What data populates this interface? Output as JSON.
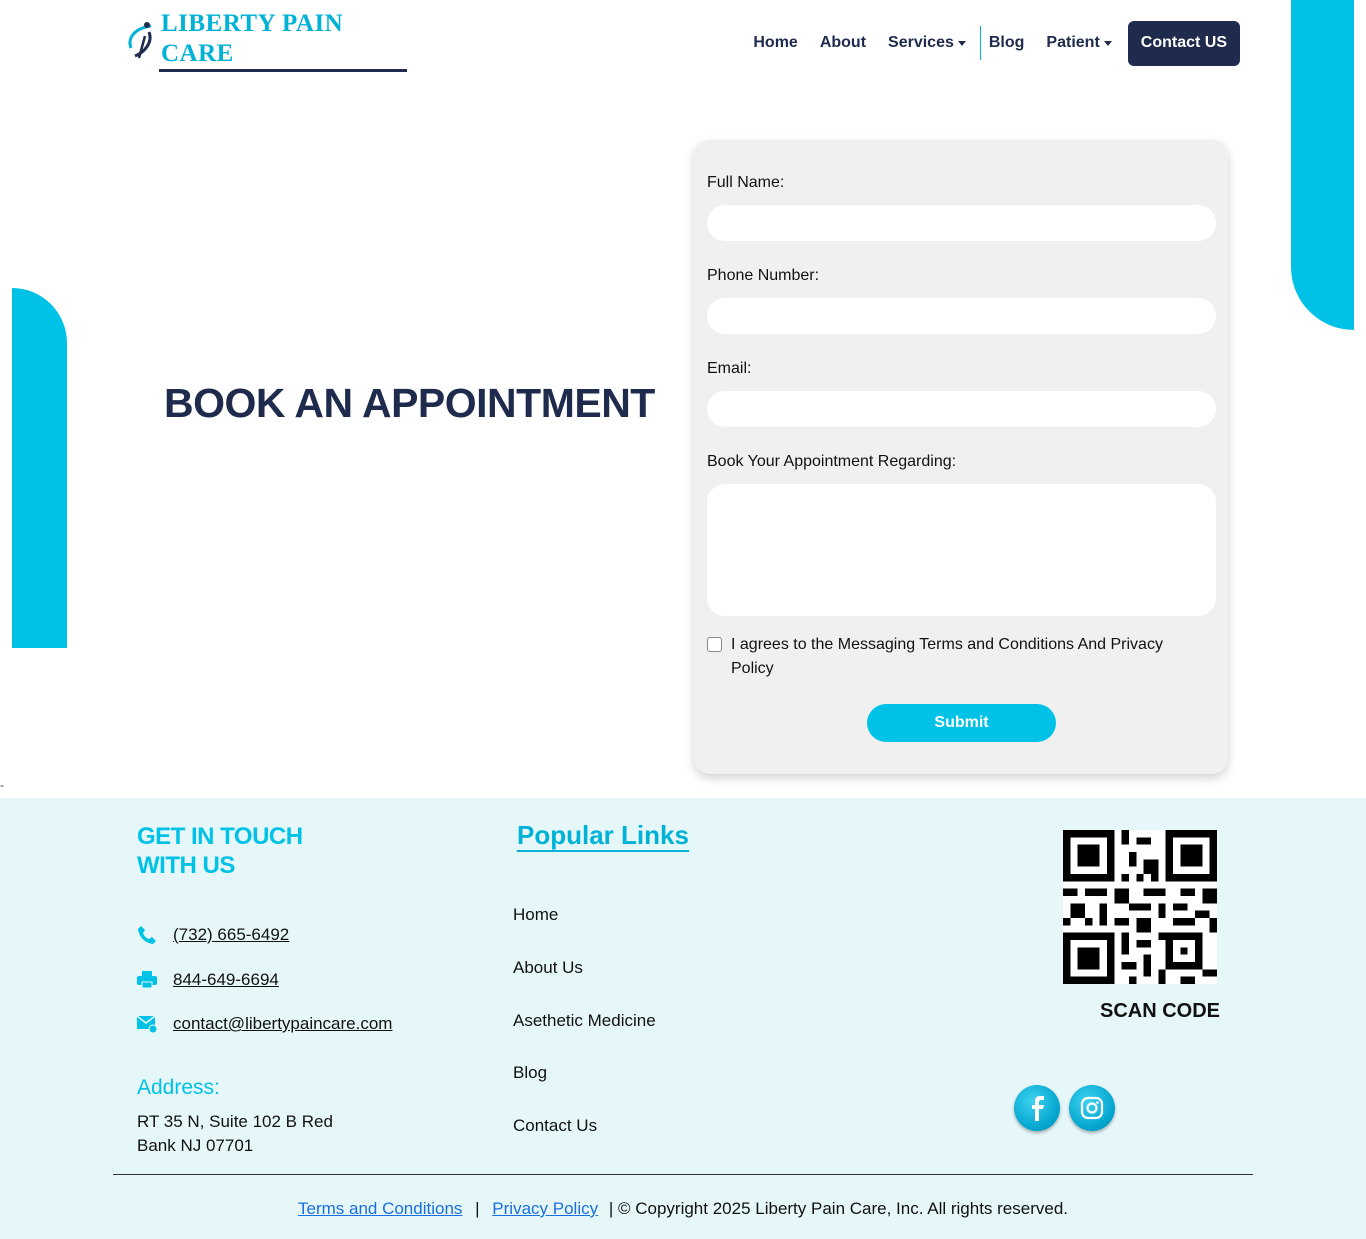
{
  "header": {
    "logo_text": "LIBERTY PAIN CARE",
    "nav": {
      "home": "Home",
      "about": "About",
      "services": "Services",
      "blog": "Blog",
      "patient": "Patient"
    },
    "contact_button": "Contact US"
  },
  "hero": {
    "title": "BOOK AN APPOINTMENT"
  },
  "form": {
    "full_name_label": "Full Name:",
    "full_name_value": "",
    "phone_label": "Phone Number:",
    "phone_value": "",
    "email_label": "Email:",
    "email_value": "",
    "regarding_label": "Book Your Appointment Regarding:",
    "regarding_value": "",
    "agree_text": "I agrees to the Messaging Terms and Conditions And Privacy Policy",
    "submit_label": "Submit"
  },
  "footer": {
    "get_in_touch": "GET IN TOUCH WITH US",
    "phone": "(732) 665-6492",
    "fax": "844-649-6694",
    "email": "contact@libertypaincare.com",
    "address_title": "Address:",
    "address": "RT 35 N, Suite 102 B Red Bank NJ 07701",
    "popular_links_title": "Popular Links",
    "links": [
      "Home",
      "About Us",
      "Asethetic Medicine",
      "Blog",
      "Contact Us"
    ],
    "scan_code": "SCAN CODE",
    "terms": "Terms and Conditions",
    "privacy": "Privacy Policy",
    "separator": "|",
    "copyright": "| © Copyright 2025 Liberty Pain Care, Inc. All rights reserved."
  },
  "colors": {
    "brand_cyan": "#00c2e6",
    "navy": "#1f2b4d",
    "footer_bg": "#e6f7fa"
  },
  "icons": [
    "logo-mark",
    "phone-icon",
    "fax-icon",
    "email-icon",
    "qr-code",
    "facebook-icon",
    "instagram-icon"
  ]
}
